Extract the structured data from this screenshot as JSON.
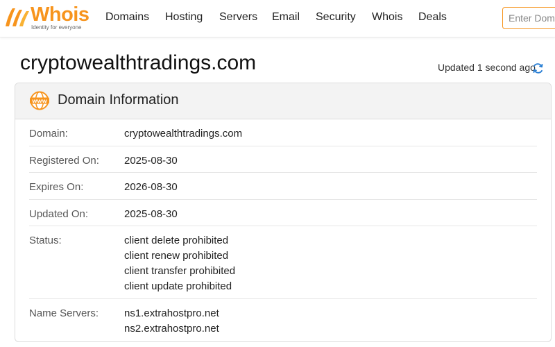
{
  "brand": {
    "name": "Whois",
    "tagline": "Identity for everyone",
    "accent": "#f7941d"
  },
  "nav": {
    "items": [
      {
        "label": "Domains"
      },
      {
        "label": "Hosting"
      },
      {
        "label": "Servers"
      },
      {
        "label": "Email"
      },
      {
        "label": "Security"
      },
      {
        "label": "Whois"
      },
      {
        "label": "Deals"
      }
    ]
  },
  "search": {
    "placeholder": "Enter Domain or IP"
  },
  "page": {
    "title": "cryptowealthtradings.com",
    "updated": "Updated 1 second ago",
    "refresh_icon": "refresh-icon"
  },
  "card": {
    "icon": "www-icon",
    "title": "Domain Information",
    "rows": [
      {
        "label": "Domain:",
        "values": [
          "cryptowealthtradings.com"
        ]
      },
      {
        "label": "Registered On:",
        "values": [
          "2025-08-30"
        ]
      },
      {
        "label": "Expires On:",
        "values": [
          "2026-08-30"
        ]
      },
      {
        "label": "Updated On:",
        "values": [
          "2025-08-30"
        ]
      },
      {
        "label": "Status:",
        "values": [
          "client delete prohibited",
          "client renew prohibited",
          "client transfer prohibited",
          "client update prohibited"
        ]
      },
      {
        "label": "Name Servers:",
        "values": [
          "ns1.extrahostpro.net",
          "ns2.extrahostpro.net"
        ]
      }
    ]
  }
}
